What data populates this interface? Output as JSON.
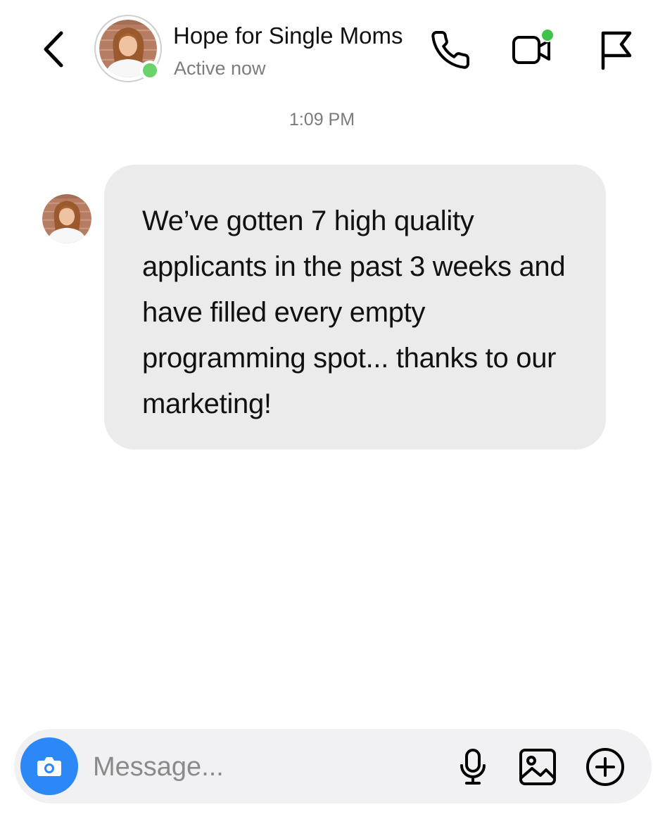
{
  "header": {
    "contact_name": "Hope for Single Moms",
    "status": "Active now",
    "online_color": "#6bd36b",
    "icons": [
      "chevron-left-icon",
      "phone-icon",
      "video-camera-icon",
      "flag-icon"
    ]
  },
  "conversation": {
    "timestamp": "1:09 PM",
    "messages": [
      {
        "sender": "Hope for Single Moms",
        "text": "We’ve gotten 7 high quality applicants in the past 3 weeks and have filled every empty programming spot... thanks to our marketing!"
      }
    ]
  },
  "composer": {
    "placeholder": "Message...",
    "value": "",
    "accent_color": "#2d88f7",
    "icons": [
      "camera-icon",
      "microphone-icon",
      "image-icon",
      "plus-circle-icon"
    ]
  }
}
